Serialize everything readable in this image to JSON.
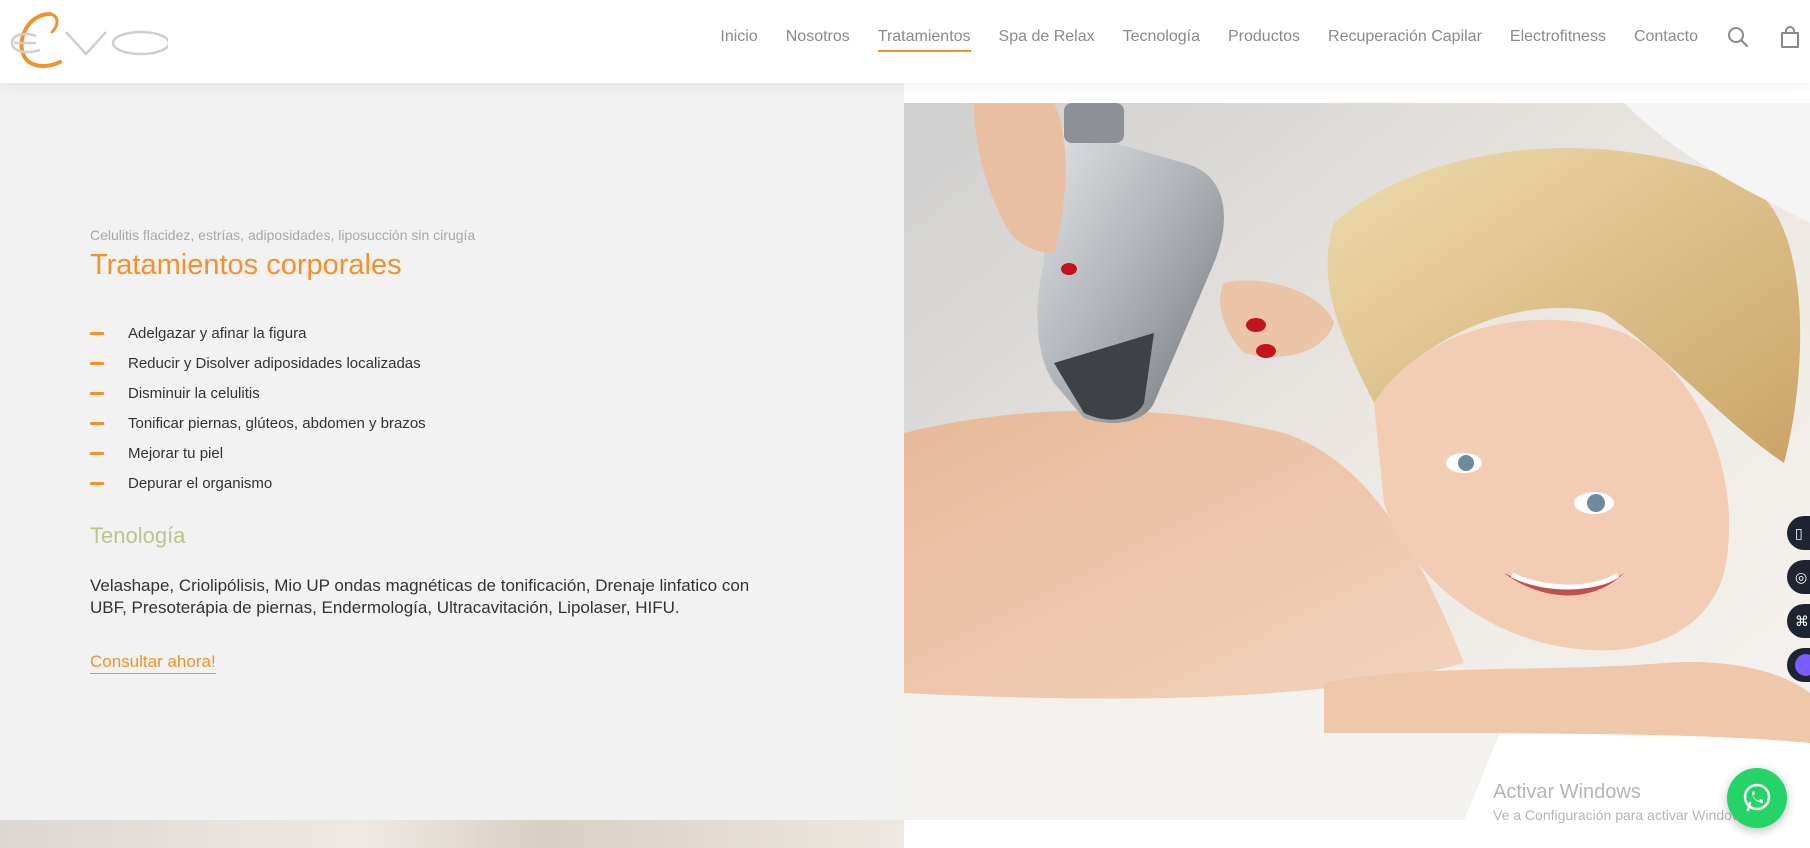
{
  "header": {
    "logo_alt": "EVO",
    "nav": [
      {
        "label": "Inicio"
      },
      {
        "label": "Nosotros"
      },
      {
        "label": "Tratamientos",
        "active": true
      },
      {
        "label": "Spa de Relax"
      },
      {
        "label": "Tecnología"
      },
      {
        "label": "Productos"
      },
      {
        "label": "Recuperación Capilar"
      },
      {
        "label": "Electrofitness"
      },
      {
        "label": "Contacto"
      }
    ],
    "icons": [
      "search-icon",
      "shopping-bag-icon"
    ]
  },
  "hero": {
    "subtitle": "Celulitis flacidez, estrías, adiposidades, liposucción sin cirugía",
    "title": "Tratamientos corporales",
    "features": [
      "Adelgazar y afinar la figura",
      "Reducir y Disolver adiposidades localizadas",
      "Disminuir la celulitis",
      "Tonificar piernas, glúteos, abdomen y brazos",
      "Mejorar tu piel",
      "Depurar el organismo"
    ],
    "tech_heading": "Tenología",
    "tech_text": "Velashape, Criolipólisis, Mio UP ondas magnéticas de tonificación, Drenaje linfatico con UBF, Presoterápia de piernas, Endermología, Ultracavitación, Lipolaser, HIFU.",
    "cta_label": "Consultar ahora!"
  },
  "overlay": {
    "windows_title": "Activar Windows",
    "windows_sub": "Ve a Configuración para activar Windows."
  },
  "colors": {
    "accent": "#f0932d",
    "tech_heading": "#bcc48a",
    "whatsapp": "#25d366"
  }
}
